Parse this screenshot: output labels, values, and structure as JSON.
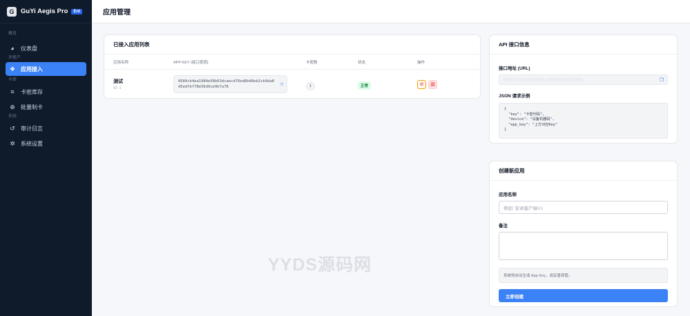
{
  "brand": {
    "name": "GuYi Aegis Pro",
    "badge": "Ent",
    "logo_letter": "G"
  },
  "sidebar": {
    "sections": [
      {
        "label": "概览",
        "items": [
          {
            "label": "仪表盘",
            "icon": "chart-pie-icon"
          }
        ]
      },
      {
        "label": "多租户",
        "items": [
          {
            "label": "应用接入",
            "icon": "cubes-icon",
            "active": true
          }
        ]
      },
      {
        "label": "卡密",
        "items": [
          {
            "label": "卡密库存",
            "icon": "database-icon"
          },
          {
            "label": "批量制卡",
            "icon": "plus-circle-icon"
          }
        ]
      },
      {
        "label": "系统",
        "items": [
          {
            "label": "审计日志",
            "icon": "history-icon"
          },
          {
            "label": "系统设置",
            "icon": "gear-icon"
          }
        ]
      }
    ]
  },
  "header": {
    "title": "应用管理"
  },
  "apps": {
    "title": "已接入应用列表",
    "columns": [
      "应用名称",
      "APP KEY (接口密钥)",
      "卡密数",
      "状态",
      "操作"
    ],
    "rows": [
      {
        "name": "测试",
        "id": "ID: 1",
        "app_key": "6684cb4ea1984e58b63dcaecd76ed8b48eb2cb9da8d5edfbf78e56d9ce9b7a78",
        "card_count": "1",
        "status": "正常"
      }
    ]
  },
  "api": {
    "title": "API 接口信息",
    "url_label": "接口地址 (URL)",
    "url_value": "https://xxxx.example.com/api/verify.php",
    "json_label": "JSON 请求示例",
    "json_example": "{\n  \"key\": \"卡密代码\",\n  \"device\": \"设备机器码\",\n  \"app_key\": \"上方对应Key\"\n}"
  },
  "create": {
    "title": "创建新应用",
    "name_label": "应用名称",
    "name_placeholder": "例如: 安卓客户端V1",
    "note_label": "备注",
    "notice": "系统将自动生成 App Key，请妥善保管。",
    "submit_label": "立即创建"
  },
  "watermark": "YYDS源码网",
  "colors": {
    "sidebar_bg": "#0f1a2b",
    "accent": "#3b82f6",
    "status_ok": "#15803d"
  }
}
